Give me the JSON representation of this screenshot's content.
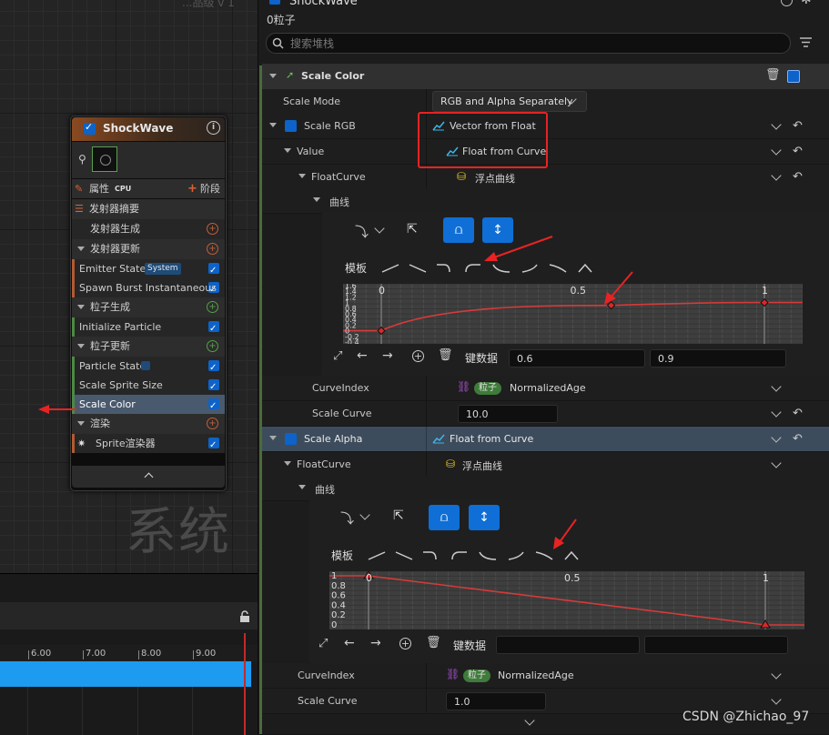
{
  "graph": {
    "label": "系统",
    "top_label": "...品级 v 1",
    "node": {
      "title": "ShockWave",
      "props_label": "属性",
      "cpu_label": "CPU",
      "stage_label": "阶段",
      "rows": [
        {
          "label": "发射器摘要",
          "kind": "summary"
        },
        {
          "label": "发射器生成",
          "kind": "indent-plus"
        },
        {
          "label": "发射器更新",
          "kind": "section"
        },
        {
          "label": "Emitter State",
          "kind": "item",
          "badge": "System"
        },
        {
          "label": "Spawn Burst Instantaneous",
          "kind": "item"
        },
        {
          "label": "粒子生成",
          "kind": "section"
        },
        {
          "label": "Initialize Particle",
          "kind": "item"
        },
        {
          "label": "粒子更新",
          "kind": "section"
        },
        {
          "label": "Particle State",
          "kind": "item"
        },
        {
          "label": "Scale Sprite Size",
          "kind": "item"
        },
        {
          "label": "Scale Color",
          "kind": "item-selected"
        },
        {
          "label": "渲染",
          "kind": "section"
        },
        {
          "label": "Sprite渲染器",
          "kind": "item"
        }
      ]
    }
  },
  "timeline": {
    "ticks": [
      "6.00",
      "7.00",
      "8.00",
      "9.00"
    ]
  },
  "panel": {
    "title": "ShockWave",
    "particles": "0粒子",
    "search_placeholder": "搜索堆栈",
    "module_title": "Scale Color",
    "scale_mode_label": "Scale Mode",
    "scale_mode_value": "RGB and Alpha Separately",
    "scale_rgb_label": "Scale RGB",
    "scale_rgb_value": "Vector from Float",
    "value_label": "Value",
    "value_value": "Float from Curve",
    "floatcurve_label": "FloatCurve",
    "floatcurve_value": "浮点曲线",
    "curve_label": "曲线",
    "template_label": "模板",
    "keydata_label": "键数据",
    "rgb_key_time": "0.6",
    "rgb_key_value": "0.9",
    "curveindex_label": "CurveIndex",
    "curveindex_pill": "粒子",
    "curveindex_value": "NormalizedAge",
    "scale_curve_label": "Scale Curve",
    "scale_curve_value": "10.0",
    "scale_alpha_label": "Scale Alpha",
    "scale_alpha_value": "Float from Curve",
    "alpha_floatcurve_label": "FloatCurve",
    "alpha_floatcurve_value": "浮点曲线",
    "alpha_curve_label": "曲线",
    "alpha_template_label": "模板",
    "alpha_keydata_label": "键数据",
    "alpha_curveindex_label": "CurveIndex",
    "alpha_curveindex_pill": "粒子",
    "alpha_curveindex_value": "NormalizedAge",
    "alpha_scale_curve_label": "Scale Curve",
    "alpha_scale_curve_value": "1.0"
  },
  "rgb_curve": {
    "x_ticks": [
      "0",
      "0.5",
      "1"
    ],
    "y_ticks": [
      "1.6",
      "1.4",
      "1.2",
      "1",
      "0.8",
      "0.6",
      "0.4",
      "0.2",
      "0",
      "-0.2",
      "-0.4"
    ],
    "keys": [
      {
        "x": 0,
        "y": 0
      },
      {
        "x": 0.6,
        "y": 0.9
      },
      {
        "x": 1,
        "y": 1
      }
    ]
  },
  "alpha_curve": {
    "x_ticks": [
      "0",
      "0.5",
      "1"
    ],
    "y_ticks": [
      "1",
      "0.8",
      "0.6",
      "0.4",
      "0.2",
      "0"
    ],
    "keys": [
      {
        "x": 0,
        "y": 1
      },
      {
        "x": 1,
        "y": 0
      }
    ]
  },
  "watermark": "CSDN @Zhichao_97",
  "colors": {
    "accent": "#0f6fd6",
    "highlight": "#e82323",
    "curve": "#d63a3a",
    "track": "#1d9bf0"
  }
}
